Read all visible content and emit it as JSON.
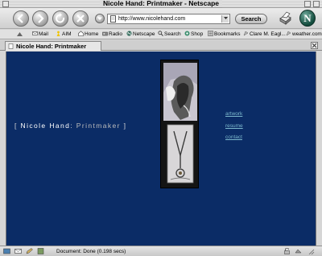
{
  "window": {
    "title": "Nicole Hand: Printmaker - Netscape"
  },
  "navbar": {
    "url": "http://www.nicolehand.com",
    "search_label": "Search",
    "logo_letter": "N"
  },
  "personal_toolbar": {
    "items": [
      {
        "label": "Mail",
        "icon": "mail-icon"
      },
      {
        "label": "AIM",
        "icon": "aim-icon"
      },
      {
        "label": "Home",
        "icon": "home-icon"
      },
      {
        "label": "Radio",
        "icon": "radio-icon"
      },
      {
        "label": "Netscape",
        "icon": "netscape-n-icon"
      },
      {
        "label": "Search",
        "icon": "search-icon"
      },
      {
        "label": "Shop",
        "icon": "shop-icon"
      },
      {
        "label": "Bookmarks",
        "icon": "bookmarks-icon"
      },
      {
        "label": "Clare M. Eagl...",
        "icon": "bookmark-link-icon"
      },
      {
        "label": "weather.com",
        "icon": "bookmark-link-icon"
      }
    ]
  },
  "tab": {
    "label": "Nicole Hand: Printmaker"
  },
  "page": {
    "title_open": "[",
    "title_name": "Nicole Hand",
    "title_colon": ":",
    "title_role": "Printmaker",
    "title_close": "]",
    "links": [
      "artwork",
      "resume",
      "contact"
    ]
  },
  "status": {
    "text": "Document: Done (0.198 secs)"
  }
}
